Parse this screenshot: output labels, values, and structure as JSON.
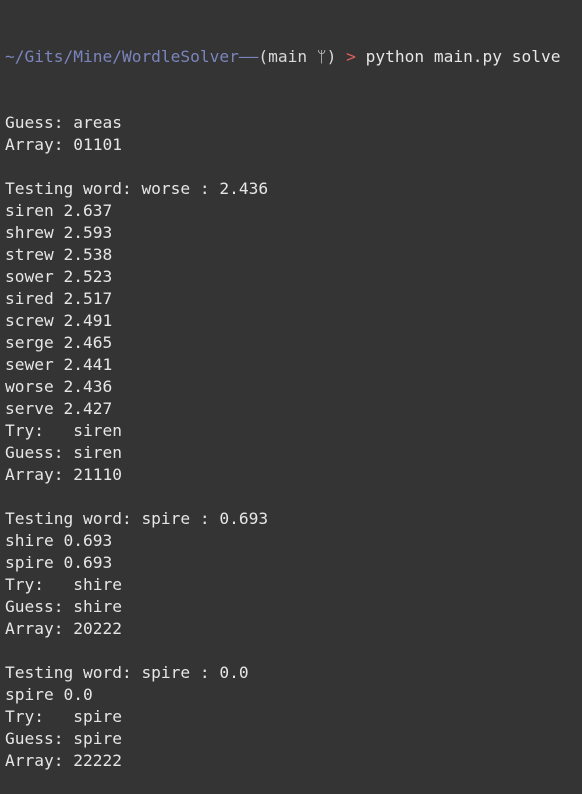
{
  "prompt": {
    "path": "~/Gits/Mine/WordleSolver",
    "connector": "——",
    "branch_open": "(main ",
    "branch_icon": "ᛘ",
    "branch_close": ")",
    "arrow": " > ",
    "command": "python main.py solve"
  },
  "output_lines": [
    "Guess: areas",
    "Array: 01101",
    "",
    "Testing word: worse : 2.436",
    "siren 2.637",
    "shrew 2.593",
    "strew 2.538",
    "sower 2.523",
    "sired 2.517",
    "screw 2.491",
    "serge 2.465",
    "sewer 2.441",
    "worse 2.436",
    "serve 2.427",
    "Try:   siren",
    "Guess: siren",
    "Array: 21110",
    "",
    "Testing word: spire : 0.693",
    "shire 0.693",
    "spire 0.693",
    "Try:   shire",
    "Guess: shire",
    "Array: 20222",
    "",
    "Testing word: spire : 0.0",
    "spire 0.0",
    "Try:   spire",
    "Guess: spire",
    "Array: 22222"
  ],
  "colors": {
    "background": "#343434",
    "text": "#e6e6e6",
    "path": "#7b85bd",
    "arrow": "#e0605a"
  }
}
